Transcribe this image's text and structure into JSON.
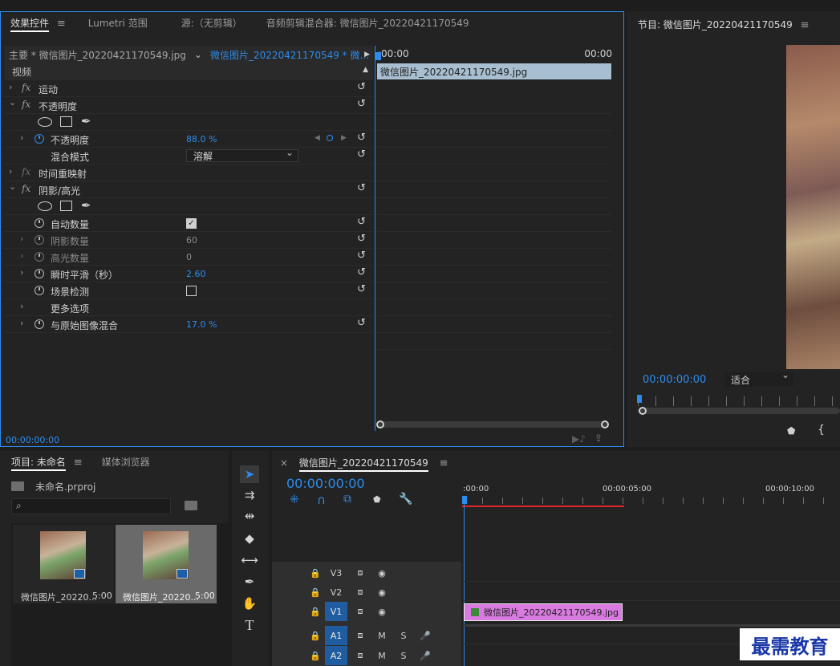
{
  "effect_controls": {
    "tabs": [
      "效果控件",
      "Lumetri 范围",
      "源:（无剪辑）",
      "音频剪辑混合器: 微信图片_20220421170549"
    ],
    "master_label": "主要 * 微信图片_20220421170549.jpg",
    "clip_label": "微信图片_20220421170549 * 微...",
    "timeline_start": ":00:00",
    "timeline_end": "00:00",
    "clip_bar_label": "微信图片_20220421170549.jpg",
    "section_video": "视频",
    "motion": "运动",
    "opacity": "不透明度",
    "opacity_prop": "不透明度",
    "opacity_value": "88.0 %",
    "blend_mode_label": "混合模式",
    "blend_mode_value": "溶解",
    "time_remap": "时间重映射",
    "shadow_highlight": "阴影/高光",
    "auto_amount": "自动数量",
    "shadow_amount": "阴影数量",
    "shadow_amount_value": "60",
    "highlight_amount": "高光数量",
    "highlight_amount_value": "0",
    "temporal_smooth": "瞬时平滑（秒）",
    "temporal_smooth_value": "2.60",
    "scene_detect": "场景检测",
    "more_options": "更多选项",
    "blend_original": "与原始图像混合",
    "blend_original_value": "17.0 %",
    "timecode": "00:00:00:00"
  },
  "program": {
    "title": "节目: 微信图片_20220421170549",
    "timecode": "00:00:00:00",
    "fit_label": "适合"
  },
  "project": {
    "tab_project": "项目: 未命名",
    "tab_media": "媒体浏览器",
    "project_file": "未命名.prproj",
    "items": [
      {
        "name": "微信图片_20220...",
        "duration": "5:00"
      },
      {
        "name": "微信图片_20220...",
        "duration": "5:00"
      }
    ]
  },
  "timeline": {
    "title": "微信图片_20220421170549",
    "timecode": "00:00:00:00",
    "ruler": [
      ":00:00",
      "00:00:05:00",
      "00:00:10:00"
    ],
    "tracks": {
      "v3": "V3",
      "v2": "V2",
      "v1": "V1",
      "a1": "A1",
      "a2": "A2",
      "m": "M",
      "s": "S"
    },
    "clip_label": "微信图片_20220421170549.jpg"
  },
  "watermark": "最需教育",
  "icons": {
    "menu": "≡",
    "close": "×",
    "reset": "↺",
    "chevron_right": "›",
    "chevron_down": "⌄",
    "play_triangle": "▶",
    "lock": "🔒",
    "eye": "◉",
    "mic": "🎤",
    "keyframe": "◇"
  },
  "colors": {
    "accent_blue": "#2d8ceb",
    "clip_pink": "#d97ae0",
    "clip_header": "#a7bfd0",
    "playhead_red": "#e0262b",
    "watermark_blue": "#1a37a8"
  }
}
